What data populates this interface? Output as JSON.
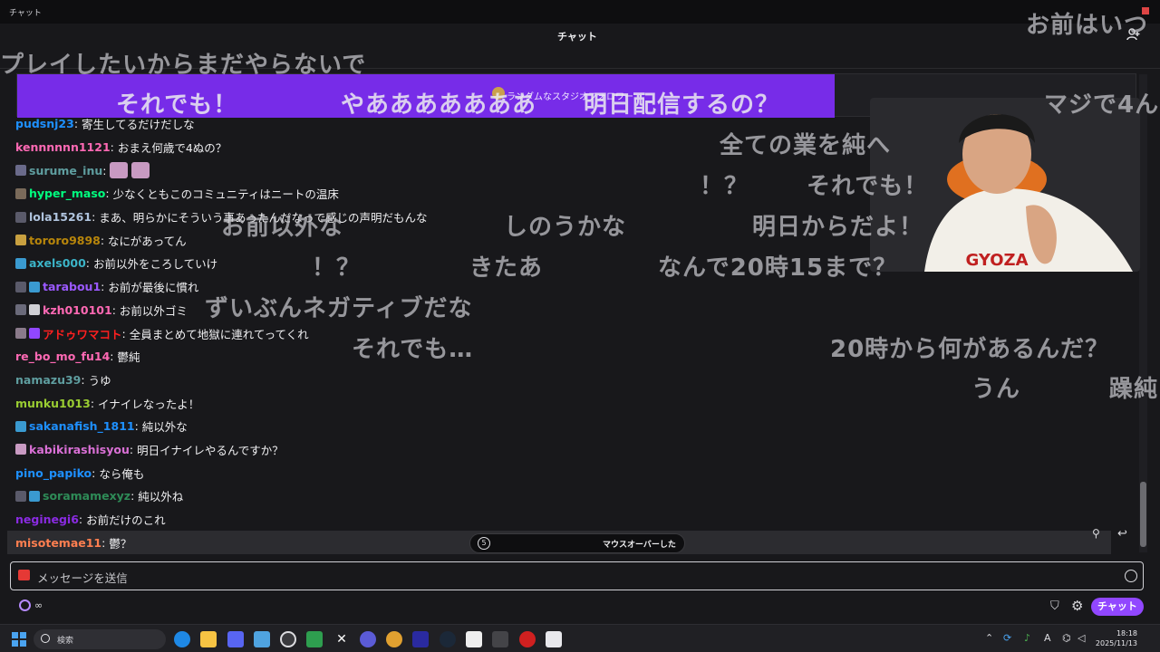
{
  "window": {
    "title": "チャット"
  },
  "header": {
    "title": "チャット",
    "users_icon": "users-icon"
  },
  "pinned": {
    "label": "ランダムなスタジオフォロワー"
  },
  "messages": [
    {
      "user": "pudsnj23",
      "color": "#1e90ff",
      "text": "寄生してるだけだしな"
    },
    {
      "user": "kennnnnn1121",
      "color": "#ff69b4",
      "text": "おまえ何歳で4ぬの？"
    },
    {
      "user": "surume_inu",
      "color": "#5f9ea0",
      "text": ""
    },
    {
      "user": "hyper_maso",
      "color": "#00ff7f",
      "text": "少なくともこのコミュニティはニートの温床"
    },
    {
      "user": "lola15261",
      "color": "#b0c4de",
      "text": "まあ、明らかにそういう事あったんだなっで感じの声明だもんな"
    },
    {
      "user": "tororo9898",
      "color": "#b8860b",
      "text": "なにがあってん"
    },
    {
      "user": "axels000",
      "color": "#3cb4c8",
      "text": "お前以外をころしていけ"
    },
    {
      "user": "tarabou1",
      "color": "#9b59ff",
      "text": "お前が最後に慣れ"
    },
    {
      "user": "kzh010101",
      "color": "#ff69b4",
      "text": "お前以外ゴミ"
    },
    {
      "user": "アドゥワマコト",
      "color": "#ff2020",
      "text": "全員まとめて地獄に連れてってくれ"
    },
    {
      "user": "re_bo_mo_fu14",
      "color": "#ff69b4",
      "text": "鬱純"
    },
    {
      "user": "namazu39",
      "color": "#5f9ea0",
      "text": "うゆ"
    },
    {
      "user": "munku1013",
      "color": "#9acd32",
      "text": "イナイレなったよ！"
    },
    {
      "user": "sakanafish_1811",
      "color": "#1e90ff",
      "text": "純以外な"
    },
    {
      "user": "kabikirashisyou",
      "color": "#da70d6",
      "text": "明日イナイレやるんですか？"
    },
    {
      "user": "pino_papiko",
      "color": "#1e90ff",
      "text": "なら俺も"
    },
    {
      "user": "soramamexyz",
      "color": "#2e8b57",
      "text": "純以外ね"
    },
    {
      "user": "neginegi6",
      "color": "#8a2be2",
      "text": "お前だけのこれ"
    },
    {
      "user": "misotemae11",
      "color": "#ff7f50",
      "text": "鬱？"
    }
  ],
  "paused": {
    "label": "マウスオーバーした"
  },
  "input": {
    "placeholder": "メッセージを送信"
  },
  "footer": {
    "points": "∞",
    "chat_button": "チャット"
  },
  "danmaku": [
    "プレイしたいからまだやらないで",
    "それでも！",
    "やあああああああ",
    "明日配信するの？",
    "マジで4ん",
    "全ての業を純へ",
    "！？",
    "それでも！",
    "お前以外な",
    "しのうかな",
    "明日からだよ！",
    "！？",
    "きたあ",
    "なんで20時15まで？",
    "ずいぶんネガティブだな",
    "それでも…",
    "20時から何があるんだ？",
    "うん",
    "躁純",
    "お前はいつ"
  ],
  "taskbar": {
    "search_label": "検索",
    "time": "18:18",
    "date": "2025/11/13"
  }
}
